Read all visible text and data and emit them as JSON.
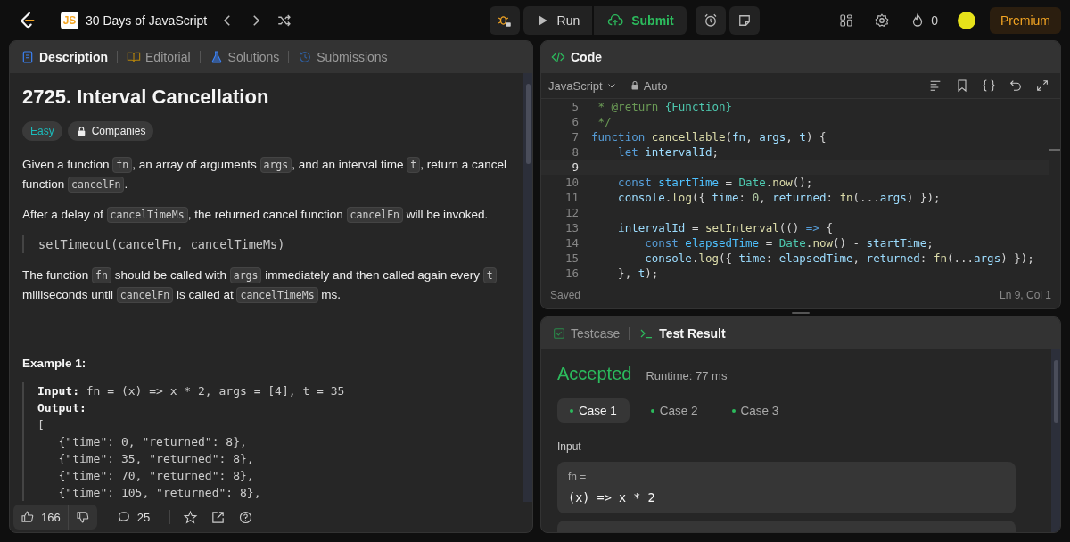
{
  "topbar": {
    "plan_badge": "JS",
    "plan_title": "30 Days of JavaScript",
    "run": "Run",
    "submit": "Submit",
    "streak": "0",
    "premium": "Premium"
  },
  "description": {
    "tabs": [
      {
        "label": "Description",
        "selected": true,
        "kind": "doc"
      },
      {
        "label": "Editorial",
        "selected": false,
        "kind": "book"
      },
      {
        "label": "Solutions",
        "selected": false,
        "kind": "flask"
      },
      {
        "label": "Submissions",
        "selected": false,
        "kind": "history"
      }
    ],
    "title": "2725. Interval Cancellation",
    "difficulty": "Easy",
    "companies": "Companies",
    "paragraphs": [
      [
        {
          "kind": "text",
          "text": "Given a function "
        },
        {
          "kind": "code",
          "text": "fn"
        },
        {
          "kind": "text",
          "text": ", an array of arguments "
        },
        {
          "kind": "code",
          "text": "args"
        },
        {
          "kind": "text",
          "text": ", and an interval time "
        },
        {
          "kind": "code",
          "text": "t"
        },
        {
          "kind": "text",
          "text": ", return a cancel function "
        },
        {
          "kind": "code",
          "text": "cancelFn"
        },
        {
          "kind": "text",
          "text": "."
        }
      ],
      [
        {
          "kind": "text",
          "text": "After a delay of "
        },
        {
          "kind": "code",
          "text": "cancelTimeMs"
        },
        {
          "kind": "text",
          "text": ", the returned cancel function "
        },
        {
          "kind": "code",
          "text": "cancelFn"
        },
        {
          "kind": "text",
          "text": " will be invoked."
        }
      ],
      [
        {
          "kind": "quote",
          "text": "setTimeout(cancelFn, cancelTimeMs)"
        }
      ],
      [
        {
          "kind": "text",
          "text": "The function "
        },
        {
          "kind": "code",
          "text": "fn"
        },
        {
          "kind": "text",
          "text": " should be called with "
        },
        {
          "kind": "code",
          "text": "args"
        },
        {
          "kind": "text",
          "text": " immediately and then called again every "
        },
        {
          "kind": "code",
          "text": "t"
        },
        {
          "kind": "text",
          "text": " milliseconds until "
        },
        {
          "kind": "code",
          "text": "cancelFn"
        },
        {
          "kind": "text",
          "text": " is called at "
        },
        {
          "kind": "code",
          "text": "cancelTimeMs"
        },
        {
          "kind": "text",
          "text": " ms."
        }
      ]
    ],
    "example": {
      "title": "Example 1:",
      "input_label": "Input:",
      "input": "fn = (x) => x * 2, args = [4], t = 35",
      "output_label": "Output:",
      "output_lines": [
        "[",
        "   {\"time\": 0, \"returned\": 8},",
        "   {\"time\": 35, \"returned\": 8},",
        "   {\"time\": 70, \"returned\": 8},",
        "   {\"time\": 105, \"returned\": 8},"
      ]
    },
    "likes": "166",
    "comments": "25"
  },
  "code": {
    "title": "Code",
    "language": "JavaScript",
    "mode": "Auto",
    "lines": [
      {
        "num": "5",
        "current": false,
        "tokens": [
          {
            "kind": "cm",
            "text": " * @return "
          },
          {
            "kind": "cls",
            "text": "{Function}"
          }
        ]
      },
      {
        "num": "6",
        "current": false,
        "tokens": [
          {
            "kind": "cm",
            "text": " */"
          }
        ]
      },
      {
        "num": "7",
        "current": false,
        "tokens": [
          {
            "kind": "kw",
            "text": "function "
          },
          {
            "kind": "fn",
            "text": "cancellable"
          },
          {
            "kind": "p",
            "text": "("
          },
          {
            "kind": "var",
            "text": "fn"
          },
          {
            "kind": "p",
            "text": ", "
          },
          {
            "kind": "var",
            "text": "args"
          },
          {
            "kind": "p",
            "text": ", "
          },
          {
            "kind": "var",
            "text": "t"
          },
          {
            "kind": "p",
            "text": ") {"
          }
        ]
      },
      {
        "num": "8",
        "current": false,
        "tokens": [
          {
            "kind": "kw",
            "text": "    let "
          },
          {
            "kind": "var",
            "text": "intervalId"
          },
          {
            "kind": "p",
            "text": ";"
          }
        ]
      },
      {
        "num": "9",
        "current": true
      },
      {
        "num": "10",
        "current": false,
        "tokens": [
          {
            "kind": "kw",
            "text": "    const "
          },
          {
            "kind": "cst",
            "text": "startTime"
          },
          {
            "kind": "p",
            "text": " = "
          },
          {
            "kind": "cls",
            "text": "Date"
          },
          {
            "kind": "p",
            "text": "."
          },
          {
            "kind": "fn",
            "text": "now"
          },
          {
            "kind": "p",
            "text": "();"
          }
        ]
      },
      {
        "num": "11",
        "current": false,
        "tokens": [
          {
            "kind": "var",
            "text": "    console"
          },
          {
            "kind": "p",
            "text": "."
          },
          {
            "kind": "fn",
            "text": "log"
          },
          {
            "kind": "p",
            "text": "({ "
          },
          {
            "kind": "var",
            "text": "time"
          },
          {
            "kind": "p",
            "text": ": "
          },
          {
            "kind": "num",
            "text": "0"
          },
          {
            "kind": "p",
            "text": ", "
          },
          {
            "kind": "var",
            "text": "returned"
          },
          {
            "kind": "p",
            "text": ": "
          },
          {
            "kind": "fn",
            "text": "fn"
          },
          {
            "kind": "p",
            "text": "(..."
          },
          {
            "kind": "var",
            "text": "args"
          },
          {
            "kind": "p",
            "text": ") });"
          }
        ]
      },
      {
        "num": "12",
        "current": false
      },
      {
        "num": "13",
        "current": false,
        "tokens": [
          {
            "kind": "var",
            "text": "    intervalId"
          },
          {
            "kind": "p",
            "text": " = "
          },
          {
            "kind": "fn",
            "text": "setInterval"
          },
          {
            "kind": "p",
            "text": "(() "
          },
          {
            "kind": "kw",
            "text": "=>"
          },
          {
            "kind": "p",
            "text": " {"
          }
        ]
      },
      {
        "num": "14",
        "current": false,
        "tokens": [
          {
            "kind": "kw",
            "text": "        const "
          },
          {
            "kind": "cst",
            "text": "elapsedTime"
          },
          {
            "kind": "p",
            "text": " = "
          },
          {
            "kind": "cls",
            "text": "Date"
          },
          {
            "kind": "p",
            "text": "."
          },
          {
            "kind": "fn",
            "text": "now"
          },
          {
            "kind": "p",
            "text": "() - "
          },
          {
            "kind": "var",
            "text": "startTime"
          },
          {
            "kind": "p",
            "text": ";"
          }
        ]
      },
      {
        "num": "15",
        "current": false,
        "tokens": [
          {
            "kind": "var",
            "text": "        console"
          },
          {
            "kind": "p",
            "text": "."
          },
          {
            "kind": "fn",
            "text": "log"
          },
          {
            "kind": "p",
            "text": "({ "
          },
          {
            "kind": "var",
            "text": "time"
          },
          {
            "kind": "p",
            "text": ": "
          },
          {
            "kind": "var",
            "text": "elapsedTime"
          },
          {
            "kind": "p",
            "text": ", "
          },
          {
            "kind": "var",
            "text": "returned"
          },
          {
            "kind": "p",
            "text": ": "
          },
          {
            "kind": "fn",
            "text": "fn"
          },
          {
            "kind": "p",
            "text": "(..."
          },
          {
            "kind": "var",
            "text": "args"
          },
          {
            "kind": "p",
            "text": ") });"
          }
        ]
      },
      {
        "num": "16",
        "current": false,
        "tokens": [
          {
            "kind": "p",
            "text": "    }, "
          },
          {
            "kind": "var",
            "text": "t"
          },
          {
            "kind": "p",
            "text": ");"
          }
        ]
      }
    ],
    "status": "Saved",
    "cursor": "Ln 9, Col 1"
  },
  "result": {
    "tabs": [
      {
        "label": "Testcase",
        "selected": false,
        "kind": "check"
      },
      {
        "label": "Test Result",
        "selected": true,
        "kind": "terminal"
      }
    ],
    "verdict": "Accepted",
    "runtime": "Runtime: 77 ms",
    "cases": [
      {
        "label": "Case 1",
        "selected": true
      },
      {
        "label": "Case 2",
        "selected": false
      },
      {
        "label": "Case 3",
        "selected": false
      }
    ],
    "input_label": "Input",
    "params": [
      {
        "name": "fn =",
        "value": "(x) => x * 2"
      }
    ]
  }
}
